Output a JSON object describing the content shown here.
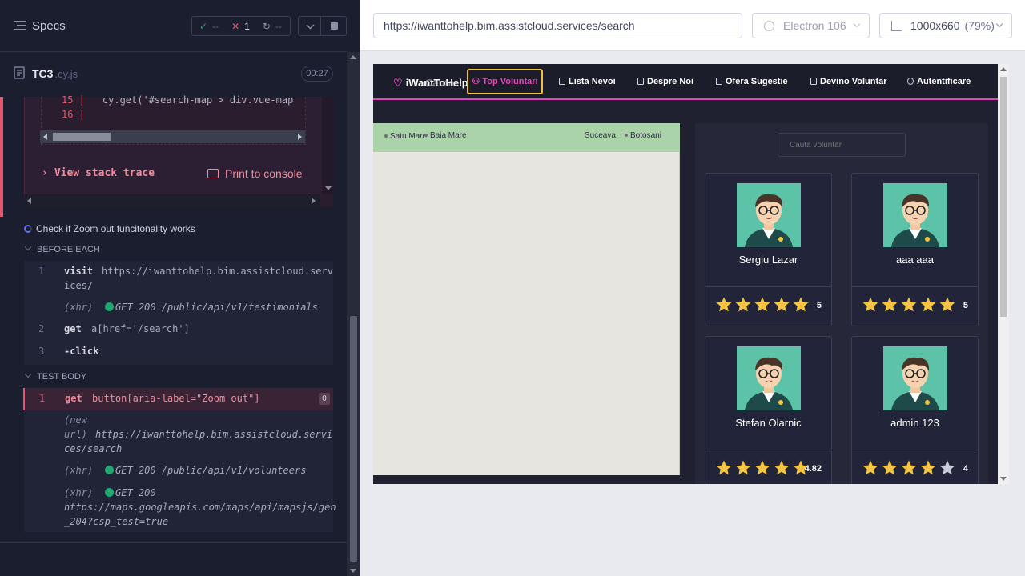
{
  "reporter": {
    "specs_title": "Specs",
    "stats": {
      "pass_icon": "✓",
      "pass_count": "--",
      "fail_icon": "✕",
      "fail_count": "1",
      "pending_icon": "↻",
      "pending_count": "--"
    },
    "file": {
      "name": "TC3",
      "ext": ".cy.js",
      "timer": "00:27"
    },
    "code_frame": {
      "lines": [
        {
          "num": "15",
          "text": "cy.get('#search-map > div.vue-map"
        },
        {
          "num": "16",
          "text": ""
        }
      ]
    },
    "view_stack_trace": "View stack trace",
    "print_to_console": "Print to console",
    "test_title": "Check if Zoom out funcitonality works",
    "before_each": {
      "title": "BEFORE EACH",
      "visit_num": "1",
      "visit_name": "visit",
      "visit_url_1": "https://iwanttohelp.bim.assistcloud.serv",
      "visit_url_2": "ices/",
      "xhr1_label": "(xhr)",
      "xhr1_text": "GET 200 /public/api/v1/testimonials",
      "get_num": "2",
      "get_name": "get",
      "get_sel": "a[href='/search']",
      "click_num": "3",
      "click_name": "-click"
    },
    "test_body": {
      "title": "TEST BODY",
      "get_num": "1",
      "get_name": "get",
      "get_sel": "button[aria-label=\"Zoom out\"]",
      "badge": "0",
      "newurl_label_1": "(new",
      "newurl_label_2": "url)",
      "newurl_1": "https://iwanttohelp.bim.assistcloud.servi",
      "newurl_2": "ces/search",
      "xhr2_label": "(xhr)",
      "xhr2_text": "GET 200 /public/api/v1/volunteers",
      "xhr3_label": "(xhr)",
      "xhr3_text": "GET 200",
      "xhr3_url_1": "https://maps.googleapis.com/maps/api/mapsjs/gen",
      "xhr3_url_2": "_204?csp_test=true"
    }
  },
  "browser": {
    "url": "https://iwanttohelp.bim.assistcloud.services/search",
    "browser_name": "Electron 106",
    "viewport": "1000x660",
    "zoom": "(79%)"
  },
  "app": {
    "logo": "iWantToHelp",
    "logo_ghost": "Cauta",
    "nav": {
      "top": "Top Voluntari",
      "needs": "Lista Nevoi",
      "about": "Despre Noi",
      "suggest": "Ofera Sugestie",
      "volunteer": "Devino Voluntar",
      "auth": "Autentificare"
    },
    "map_labels": {
      "satu_mare": "Satu Mare",
      "baia_mare": "Baia Mare",
      "suceava": "Suceava",
      "botosani": "Botoșani"
    },
    "search_placeholder": "Cauta voluntar",
    "volunteers": [
      {
        "name": "Sergiu Lazar",
        "rating": "5",
        "stars": 5
      },
      {
        "name": "aaa aaa",
        "rating": "5",
        "stars": 5
      },
      {
        "name": "Stefan Olarnic",
        "rating": "4.82",
        "stars": 5
      },
      {
        "name": "admin 123",
        "rating": "4",
        "stars": 4
      }
    ],
    "colors": {
      "accent": "#e048b8",
      "highlight": "#f0c043",
      "star": "#f5c542",
      "star_empty": "#c8cad6"
    }
  }
}
